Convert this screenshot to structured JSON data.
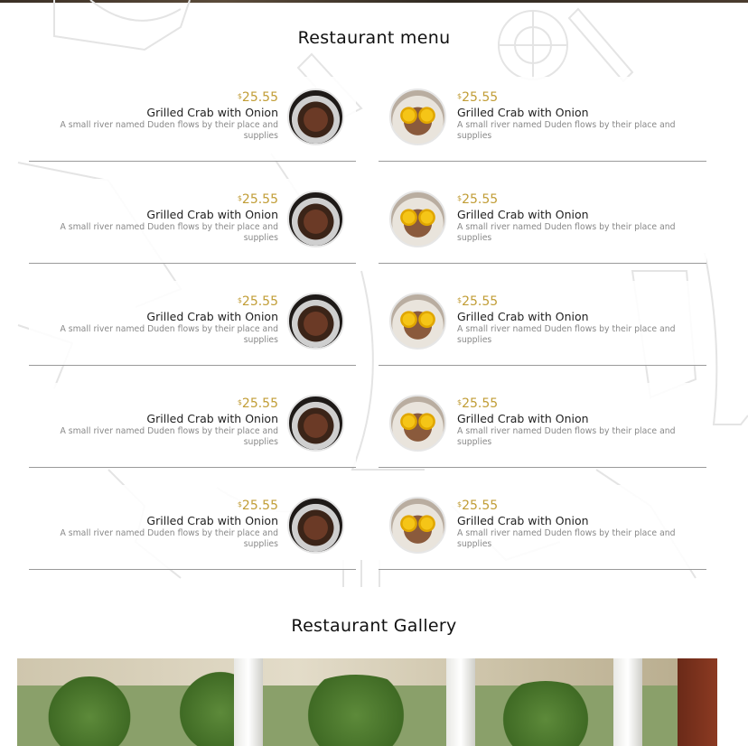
{
  "menu": {
    "title": "Restaurant menu",
    "items_left": [
      {
        "currency": "$",
        "price": "25.55",
        "name": "Grilled Crab with Onion",
        "description": "A small river named Duden flows by their place and supplies"
      },
      {
        "currency": "$",
        "price": "25.55",
        "name": "Grilled Crab with Onion",
        "description": "A small river named Duden flows by their place and supplies"
      },
      {
        "currency": "$",
        "price": "25.55",
        "name": "Grilled Crab with Onion",
        "description": "A small river named Duden flows by their place and supplies"
      },
      {
        "currency": "$",
        "price": "25.55",
        "name": "Grilled Crab with Onion",
        "description": "A small river named Duden flows by their place and supplies"
      },
      {
        "currency": "$",
        "price": "25.55",
        "name": "Grilled Crab with Onion",
        "description": "A small river named Duden flows by their place and supplies"
      }
    ],
    "items_right": [
      {
        "currency": "$",
        "price": "25.55",
        "name": "Grilled Crab with Onion",
        "description": "A small river named Duden flows by their place and supplies"
      },
      {
        "currency": "$",
        "price": "25.55",
        "name": "Grilled Crab with Onion",
        "description": "A small river named Duden flows by their place and supplies"
      },
      {
        "currency": "$",
        "price": "25.55",
        "name": "Grilled Crab with Onion",
        "description": "A small river named Duden flows by their place and supplies"
      },
      {
        "currency": "$",
        "price": "25.55",
        "name": "Grilled Crab with Onion",
        "description": "A small river named Duden flows by their place and supplies"
      },
      {
        "currency": "$",
        "price": "25.55",
        "name": "Grilled Crab with Onion",
        "description": "A small river named Duden flows by their place and supplies"
      }
    ]
  },
  "gallery": {
    "title": "Restaurant Gallery"
  },
  "colors": {
    "price_accent": "#c19d36",
    "divider": "#9a9a9a",
    "title_text": "#111111"
  },
  "icons": {
    "left_dish_image": "steak-dish-image",
    "right_dish_image": "egg-dish-image"
  }
}
